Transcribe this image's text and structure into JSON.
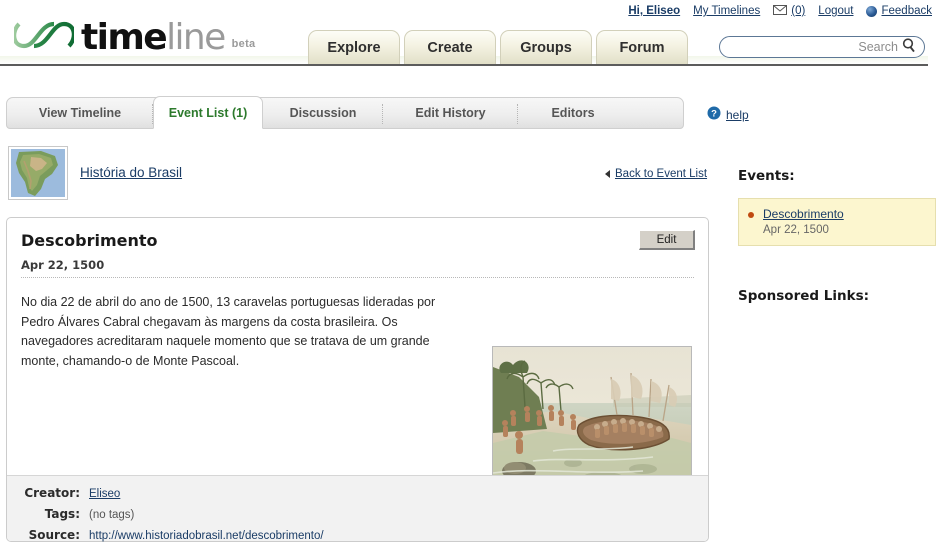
{
  "utility": {
    "greeting": "Hi, Eliseo",
    "my_timelines": "My Timelines",
    "mail_icon": "envelope-icon",
    "mail_count": "(0)",
    "logout": "Logout",
    "feedback_icon": "globe-icon",
    "feedback": "Feedback"
  },
  "brand": {
    "logo_icon": "infinity-loops-logo",
    "word_1": "time",
    "word_2": "line",
    "beta": "beta",
    "accent_green": "#2d7a2d",
    "logo_green_dark": "#18703a",
    "logo_green_light": "#8cc38c"
  },
  "main_nav": {
    "tabs": [
      {
        "label": "Explore"
      },
      {
        "label": "Create"
      },
      {
        "label": "Groups"
      },
      {
        "label": "Forum"
      }
    ]
  },
  "search": {
    "value": "",
    "placeholder": "Search",
    "icon": "magnifier-icon"
  },
  "sub_tabs": {
    "items": [
      {
        "label": "View Timeline",
        "active": false
      },
      {
        "label": "Event List (1)",
        "active": true
      },
      {
        "label": "Discussion",
        "active": false
      },
      {
        "label": "Edit History",
        "active": false
      },
      {
        "label": "Editors",
        "active": false
      }
    ],
    "help_label": "help",
    "help_icon": "question-mark-icon"
  },
  "timeline": {
    "thumbnail_icon": "south-america-map-thumbnail",
    "title": "História do Brasil",
    "back_label": "Back to Event List",
    "back_icon": "left-triangle-icon"
  },
  "event": {
    "name": "Descobrimento",
    "date": "Apr 22, 1500",
    "edit_label": "Edit",
    "body": "No dia 22 de abril do ano de 1500, 13 caravelas portuguesas lideradas por Pedro Álvares Cabral chegavam às margens da costa brasileira. Os navegadores acreditaram naquele momento que se tratava de um grande monte, chamando-o de Monte Pascoal.",
    "image_icon": "landing-of-cabral-painting",
    "meta": {
      "creator_label": "Creator:",
      "creator_value": "Eliseo",
      "tags_label": "Tags:",
      "tags_value": "(no tags)",
      "source_label": "Source:",
      "source_value": "http://www.historiadobrasil.net/descobrimento/"
    }
  },
  "sidebar": {
    "events_heading": "Events:",
    "events": [
      {
        "title": "Descobrimento",
        "date": "Apr 22, 1500"
      }
    ],
    "sponsored_heading": "Sponsored Links:"
  }
}
